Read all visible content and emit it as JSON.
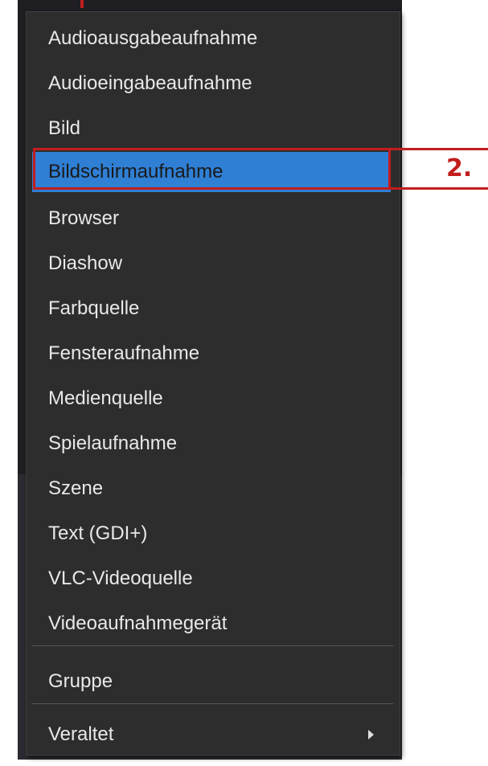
{
  "menu": {
    "items": [
      {
        "label": "Audioausgabeaufnahme"
      },
      {
        "label": "Audioeingabeaufnahme"
      },
      {
        "label": "Bild"
      },
      {
        "label": "Bildschirmaufnahme",
        "selected": true
      },
      {
        "label": "Browser"
      },
      {
        "label": "Diashow"
      },
      {
        "label": "Farbquelle"
      },
      {
        "label": "Fensteraufnahme"
      },
      {
        "label": "Medienquelle"
      },
      {
        "label": "Spielaufnahme"
      },
      {
        "label": "Szene"
      },
      {
        "label": "Text (GDI+)"
      },
      {
        "label": "VLC-Videoquelle"
      },
      {
        "label": "Videoaufnahmegerät"
      }
    ],
    "group_label": "Gruppe",
    "deprecated_label": "Veraltet",
    "submenu_icon": "chevron-right-icon"
  },
  "annotation": {
    "label": "2.",
    "color": "#c21d1d"
  },
  "colors": {
    "menu_bg": "#2d2d2d",
    "selection": "#2f7fd4",
    "text": "#e8e8e8"
  }
}
